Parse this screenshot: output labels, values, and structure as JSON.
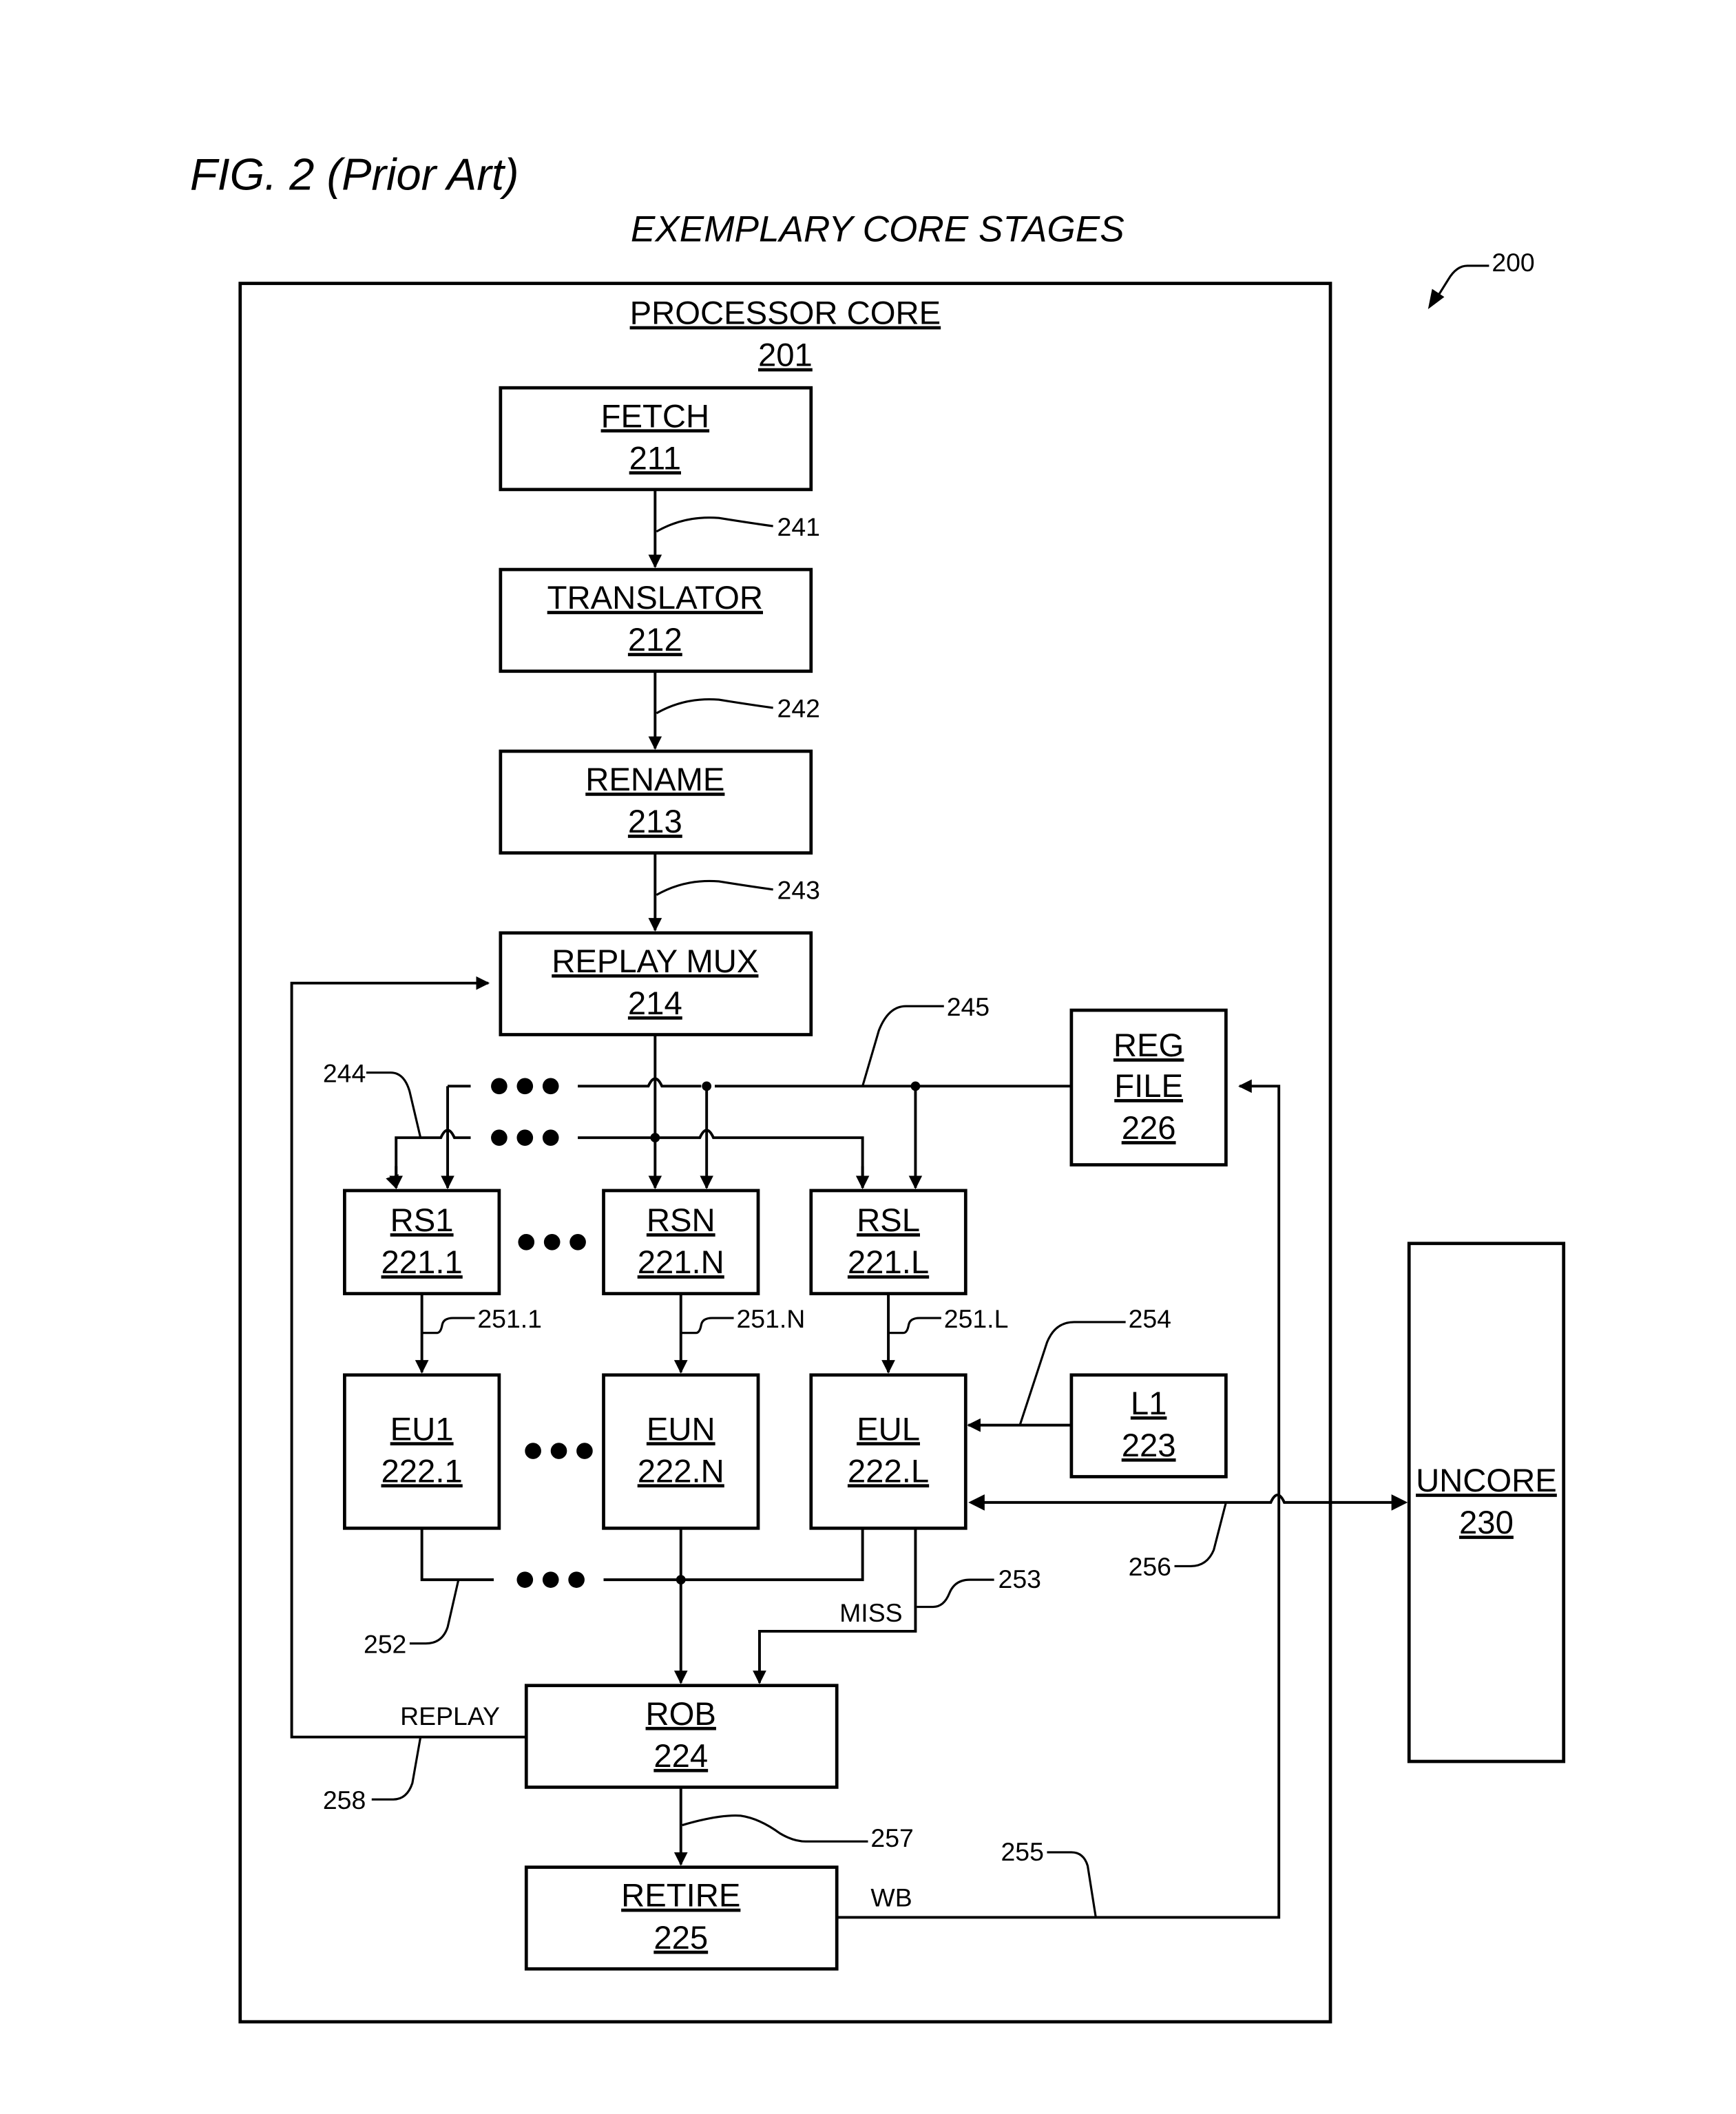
{
  "figure": {
    "title": "FIG. 2 (Prior Art)",
    "subtitle": "EXEMPLARY CORE STAGES",
    "ref": "200"
  },
  "core": {
    "name": "PROCESSOR CORE",
    "ref": "201"
  },
  "blocks": {
    "fetch": {
      "name": "FETCH",
      "ref": "211"
    },
    "translator": {
      "name": "TRANSLATOR",
      "ref": "212"
    },
    "rename": {
      "name": "RENAME",
      "ref": "213"
    },
    "replay_mux": {
      "name": "REPLAY MUX",
      "ref": "214"
    },
    "rs1": {
      "name": "RS1",
      "ref": "221.1"
    },
    "rsn": {
      "name": "RSN",
      "ref": "221.N"
    },
    "rsl": {
      "name": "RSL",
      "ref": "221.L"
    },
    "eu1": {
      "name": "EU1",
      "ref": "222.1"
    },
    "eun": {
      "name": "EUN",
      "ref": "222.N"
    },
    "eul": {
      "name": "EUL",
      "ref": "222.L"
    },
    "l1": {
      "name": "L1",
      "ref": "223"
    },
    "rob": {
      "name": "ROB",
      "ref": "224"
    },
    "retire": {
      "name": "RETIRE",
      "ref": "225"
    },
    "reg_file": {
      "name1": "REG",
      "name2": "FILE",
      "ref": "226"
    },
    "uncore": {
      "name": "UNCORE",
      "ref": "230"
    }
  },
  "signals": {
    "s241": "241",
    "s242": "242",
    "s243": "243",
    "s244": "244",
    "s245": "245",
    "s251_1": "251.1",
    "s251_n": "251.N",
    "s251_l": "251.L",
    "s252": "252",
    "s253": "253",
    "s254": "254",
    "s255": "255",
    "s256": "256",
    "s257": "257",
    "s258": "258"
  },
  "signal_labels": {
    "miss": "MISS",
    "replay": "REPLAY",
    "wb": "WB"
  },
  "ellipsis": "●●●"
}
